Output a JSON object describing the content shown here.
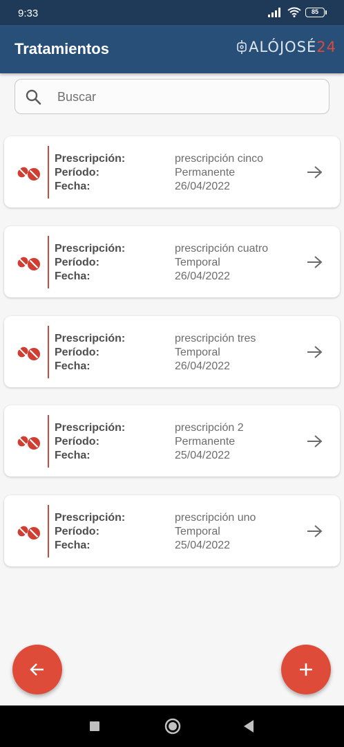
{
  "status_bar": {
    "time": "9:33",
    "battery": "85",
    "icons": [
      "signal-icon",
      "wifi-icon",
      "battery-icon"
    ]
  },
  "app_bar": {
    "title": "Tratamientos",
    "logo_text": "ALÓJOSÉ",
    "logo_number": "24"
  },
  "search": {
    "placeholder": "Buscar"
  },
  "labels": {
    "prescription": "Prescripción:",
    "period": "Período:",
    "date": "Fecha:"
  },
  "treatments": [
    {
      "prescription": "prescripción cinco",
      "period": "Permanente",
      "date": "26/04/2022"
    },
    {
      "prescription": "prescripción cuatro",
      "period": "Temporal",
      "date": "26/04/2022"
    },
    {
      "prescription": "prescripción tres",
      "period": "Temporal",
      "date": "26/04/2022"
    },
    {
      "prescription": "prescripción 2",
      "period": "Permanente",
      "date": "25/04/2022"
    },
    {
      "prescription": "prescripción uno",
      "period": "Temporal",
      "date": "25/04/2022"
    }
  ],
  "colors": {
    "app_bar": "#284f78",
    "status_bar": "#1f3a58",
    "accent": "#de4b39",
    "card_divider": "#c74b3e",
    "background": "#f6f6f6"
  },
  "icons": {
    "card_icon": "pills-icon",
    "card_action": "arrow-right-icon",
    "back_fab": "arrow-left-icon",
    "add_fab": "plus-icon"
  }
}
